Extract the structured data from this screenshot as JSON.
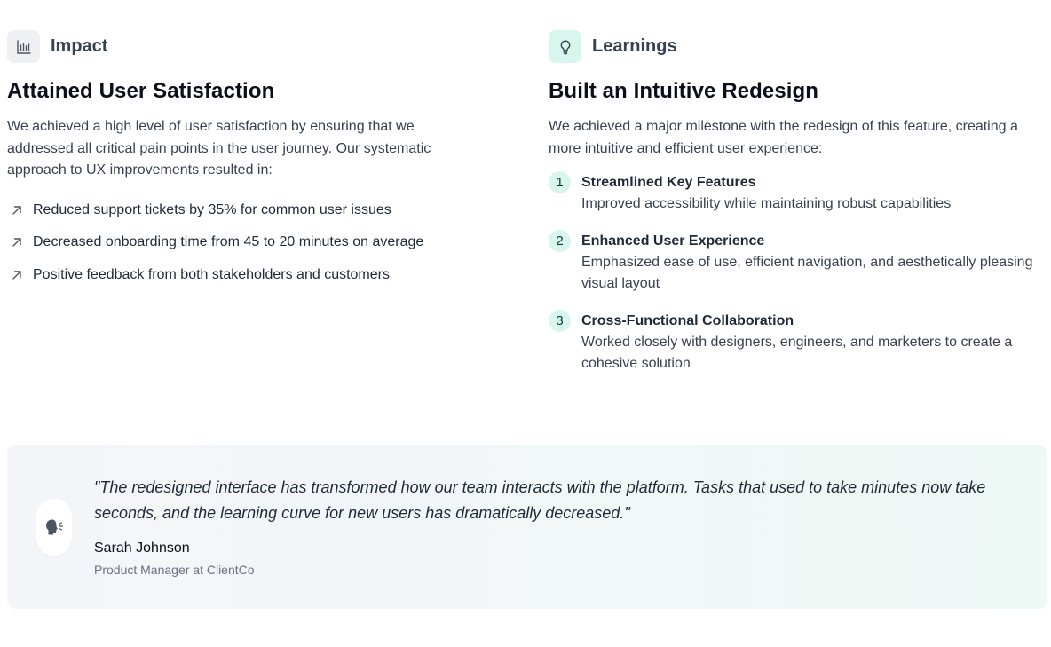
{
  "impact": {
    "label": "Impact",
    "icon": "bar-chart-icon",
    "title": "Attained User Satisfaction",
    "description": "We achieved a high level of user satisfaction by ensuring that we addressed all critical pain points in the user journey. Our systematic approach to UX improvements resulted in:",
    "results": [
      "Reduced support tickets by 35% for common user issues",
      "Decreased onboarding time from 45 to 20 minutes on average",
      "Positive feedback from both stakeholders and customers"
    ]
  },
  "learnings": {
    "label": "Learnings",
    "icon": "lightbulb-icon",
    "title": "Built an Intuitive Redesign",
    "description": "We achieved a major milestone with the redesign of this feature, creating a more intuitive and efficient user experience:",
    "items": [
      {
        "number": "1",
        "title": "Streamlined Key Features",
        "description": "Improved accessibility while maintaining robust capabilities"
      },
      {
        "number": "2",
        "title": "Enhanced User Experience",
        "description": "Emphasized ease of use, efficient navigation, and aesthetically pleasing visual layout"
      },
      {
        "number": "3",
        "title": "Cross-Functional Collaboration",
        "description": "Worked closely with designers, engineers, and marketers to create a cohesive solution"
      }
    ]
  },
  "testimonial": {
    "icon": "speaking-head-icon",
    "quote": "\"The redesigned interface has transformed how our team interacts with the platform. Tasks that used to take minutes now take seconds, and the learning curve for new users has dramatically decreased.\"",
    "name": "Sarah Johnson",
    "role": "Product Manager at ClientCo"
  },
  "colors": {
    "accent_mint": "#d8f5ee",
    "icon_gray_bg": "#eef0f4",
    "text_dark": "#0b0f19"
  }
}
